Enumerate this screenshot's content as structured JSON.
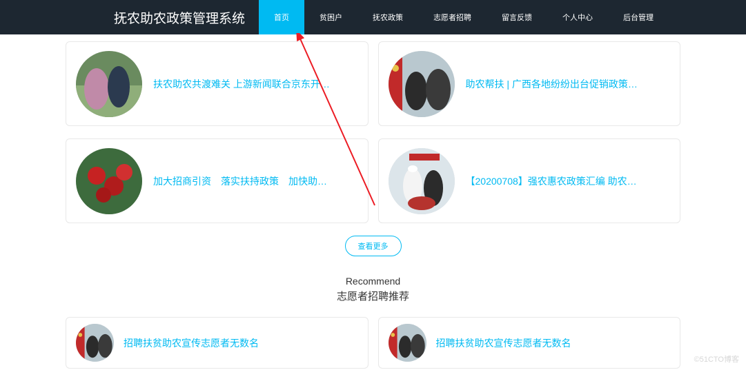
{
  "nav": {
    "brand": "抚农助农政策管理系统",
    "items": [
      {
        "label": "首页",
        "active": true
      },
      {
        "label": "贫困户",
        "active": false
      },
      {
        "label": "抚农政策",
        "active": false
      },
      {
        "label": "志愿者招聘",
        "active": false
      },
      {
        "label": "留言反馈",
        "active": false
      },
      {
        "label": "个人中心",
        "active": false
      },
      {
        "label": "后台管理",
        "active": false
      }
    ]
  },
  "policy_cards": [
    [
      {
        "title": "扶农助农共渡难关  上游新闻联合京东开…",
        "thumb": "people-orchard"
      },
      {
        "title": "助农帮扶 | 广西各地纷纷出台促销政策…",
        "thumb": "farmer-red"
      }
    ],
    [
      {
        "title": "加大招商引资　落实扶持政策　加快助…",
        "thumb": "red-fruit"
      },
      {
        "title": "【20200708】强农惠农政策汇编 助农…",
        "thumb": "chef-group"
      }
    ]
  ],
  "view_more": "查看更多",
  "section": {
    "en": "Recommend",
    "zh": "志愿者招聘推荐"
  },
  "recruit_cards": [
    {
      "title": "招聘扶贫助农宣传志愿者无数名",
      "thumb": "farmer-red"
    },
    {
      "title": "招聘扶贫助农宣传志愿者无数名",
      "thumb": "farmer-red"
    }
  ],
  "watermark": "©51CTO博客"
}
